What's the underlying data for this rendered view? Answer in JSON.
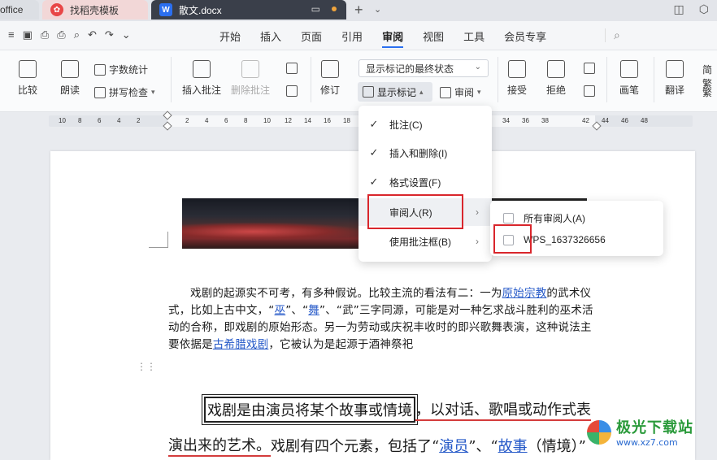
{
  "tabs": {
    "office_label": "office",
    "template_label": "找稻壳模板",
    "doc_label": "散文.docx",
    "plus": "+",
    "more": "⌄"
  },
  "menu": {
    "items": [
      "开始",
      "插入",
      "页面",
      "引用",
      "审阅",
      "视图",
      "工具",
      "会员专享"
    ],
    "active": "审阅"
  },
  "ribbon": {
    "compare": "比较",
    "read_aloud": "朗读",
    "word_count": "字数统计",
    "spell_check": "拼写检查",
    "insert_comment": "插入批注",
    "delete_comment": "删除批注",
    "revise": "修订",
    "markup_state": "显示标记的最终状态",
    "show_markup": "显示标记",
    "review": "审阅",
    "accept": "接受",
    "reject": "拒绝",
    "pen": "画笔",
    "translate": "翻译",
    "trad": "简繁",
    "trad_short": "繁"
  },
  "ruler": {
    "ticks": [
      "10",
      "8",
      "6",
      "4",
      "2",
      "2",
      "4",
      "6",
      "8",
      "10",
      "12",
      "14",
      "16",
      "18",
      "20",
      "22",
      "24",
      "26",
      "28",
      "30",
      "32",
      "34",
      "36",
      "38",
      "42",
      "44",
      "46",
      "48"
    ]
  },
  "dropdown": {
    "items": [
      {
        "label": "批注(C)",
        "checked": true,
        "submenu": false
      },
      {
        "label": "插入和删除(I)",
        "checked": true,
        "submenu": false
      },
      {
        "label": "格式设置(F)",
        "checked": true,
        "submenu": false
      },
      {
        "label": "审阅人(R)",
        "checked": false,
        "submenu": true
      },
      {
        "label": "使用批注框(B)",
        "checked": false,
        "submenu": true
      }
    ],
    "check_glyph": "✓",
    "chevron_glyph": "›"
  },
  "submenu": {
    "items": [
      {
        "label": "所有审阅人(A)",
        "checked": false
      },
      {
        "label": "WPS_1637326656",
        "checked": false
      }
    ]
  },
  "document": {
    "p1_a": "戏剧的起源实不可考，有多种假说。比较主流的看法有二：一为",
    "p1_link1": "原始宗教",
    "p1_b": "的武术仪式，比如上古中文，“",
    "p1_link2": "巫",
    "p1_c": "”、“",
    "p1_link3": "舞",
    "p1_d": "”、“武”三字同源，可能是对一种乞求战斗胜利的巫术活动的合称，即戏剧的原始形态。另一为劳动或庆祝丰收时的即兴歌舞表演，这种说法主要依据是",
    "p1_link4": "古希腊戏剧",
    "p1_e": "，它被认为是起源于酒神祭祀",
    "p2_boxed": "戏剧是由演员将某个故事或情境",
    "p2_rest": "，以对话、歌唱或动作式表",
    "p3_a": "演出来的艺术。",
    "p3_b": "戏剧有四个元素，包括了“",
    "p3_link1": "演员",
    "p3_c": "”、“",
    "p3_link2": "故事",
    "p3_d": "（情境）”"
  },
  "watermark": {
    "title": "极光下载站",
    "url": "www.xz7.com"
  },
  "colors": {
    "accent": "#2b6ff0",
    "highlight_red": "#d9262c",
    "doc_tab_bg": "#3a3f4a"
  }
}
